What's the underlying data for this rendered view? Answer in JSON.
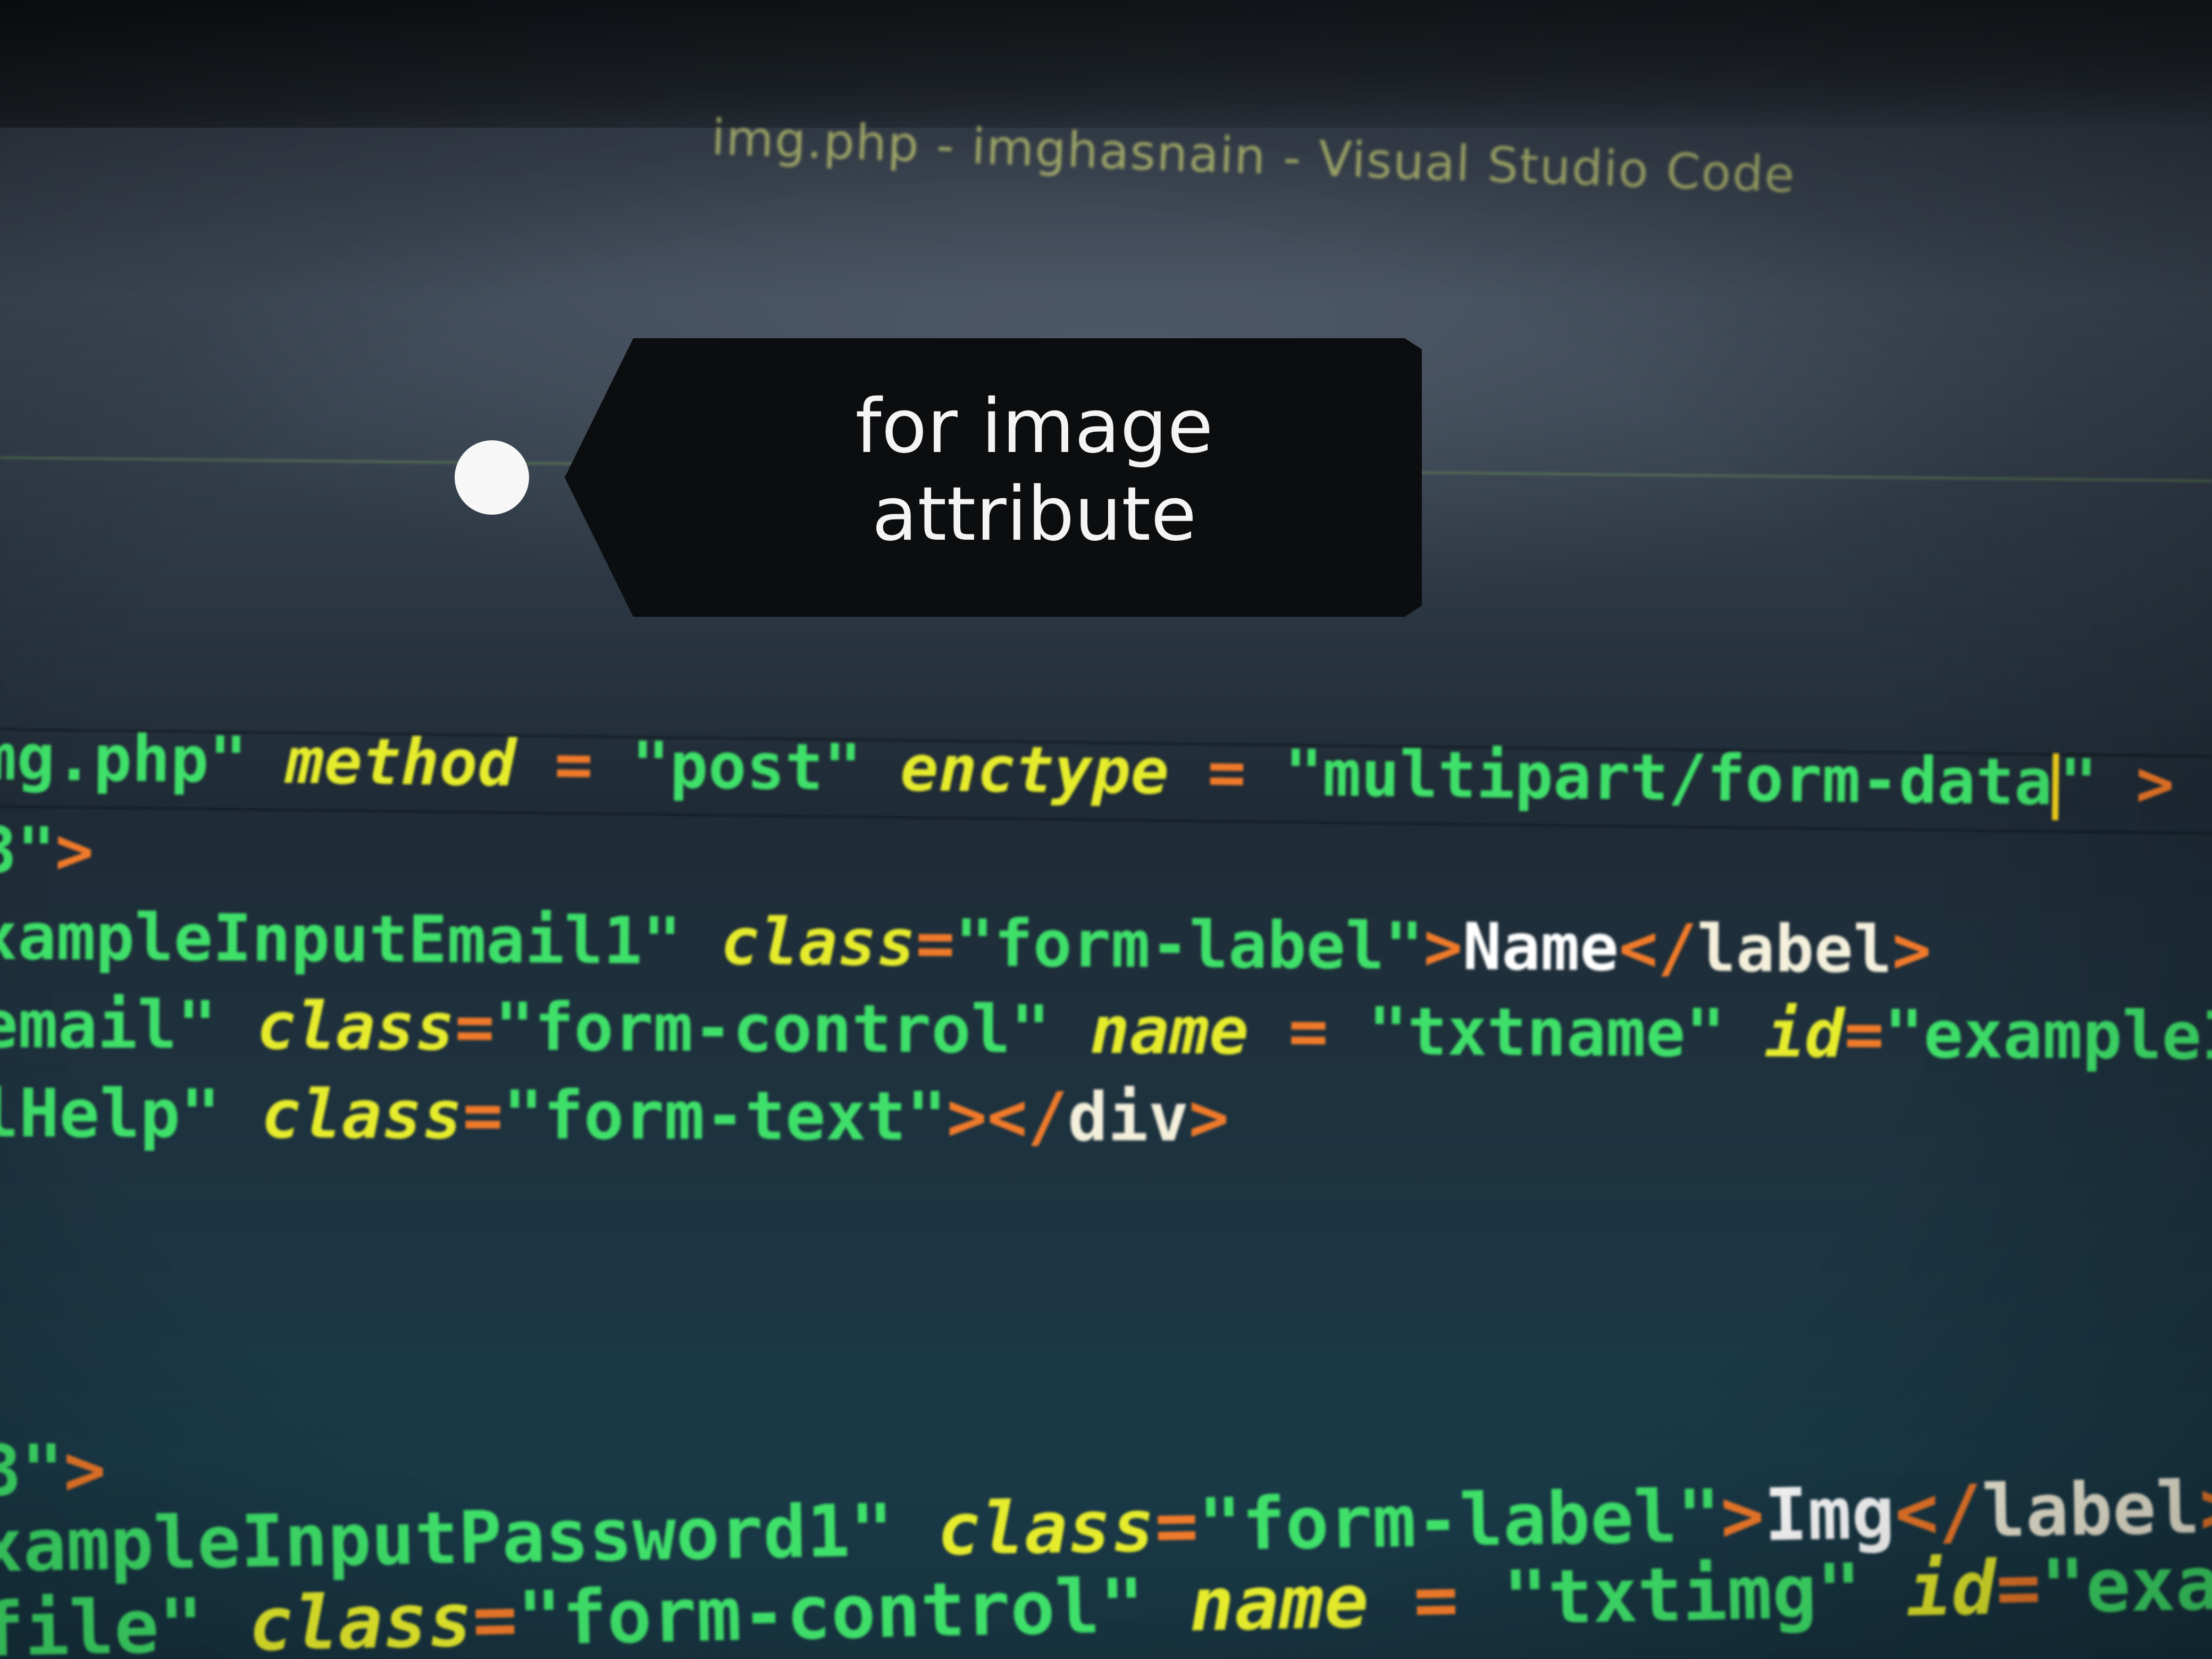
{
  "window": {
    "title": "img.php - imghasnain - Visual Studio Code"
  },
  "callout": {
    "line1": "for image",
    "line2": "attribute"
  },
  "colors": {
    "string": "#3fe06a",
    "attribute": "#e6ec2c",
    "operator": "#f07a2a",
    "tag_text": "#f4f0dc",
    "callout_background": "#0c0d0f",
    "title": "#b5bc70"
  },
  "code_lines": [
    [
      {
        "t": "mg.php\" ",
        "k": "str"
      },
      {
        "t": "method",
        "k": "attr"
      },
      {
        "t": " = ",
        "k": "op"
      },
      {
        "t": "\"post\" ",
        "k": "str"
      },
      {
        "t": "enctype",
        "k": "attr"
      },
      {
        "t": " = ",
        "k": "op"
      },
      {
        "t": "\"multipart/form-data",
        "k": "str"
      },
      {
        "t": "",
        "k": "cursor"
      },
      {
        "t": "\" ",
        "k": "str"
      },
      {
        "t": ">",
        "k": "op"
      }
    ],
    [
      {
        "t": "3\"",
        "k": "str"
      },
      {
        "t": ">",
        "k": "op"
      }
    ],
    [
      {
        "t": "xampleInputEmail1\" ",
        "k": "str"
      },
      {
        "t": "class",
        "k": "attr"
      },
      {
        "t": "=",
        "k": "op"
      },
      {
        "t": "\"form-label\"",
        "k": "str"
      },
      {
        "t": ">",
        "k": "op"
      },
      {
        "t": "Name",
        "k": "white"
      },
      {
        "t": "</",
        "k": "op"
      },
      {
        "t": "label",
        "k": "text"
      },
      {
        "t": ">",
        "k": "op"
      }
    ],
    [
      {
        "t": "email\" ",
        "k": "str"
      },
      {
        "t": "class",
        "k": "attr"
      },
      {
        "t": "=",
        "k": "op"
      },
      {
        "t": "\"form-control\" ",
        "k": "str"
      },
      {
        "t": "name",
        "k": "attr"
      },
      {
        "t": " = ",
        "k": "op"
      },
      {
        "t": "\"txtname\" ",
        "k": "str"
      },
      {
        "t": "id",
        "k": "attr"
      },
      {
        "t": "=",
        "k": "op"
      },
      {
        "t": "\"exampleInputEmail",
        "k": "str"
      }
    ],
    [
      {
        "t": "lHelp\" ",
        "k": "str"
      },
      {
        "t": "class",
        "k": "attr"
      },
      {
        "t": "=",
        "k": "op"
      },
      {
        "t": "\"form-text\"",
        "k": "str"
      },
      {
        "t": "></",
        "k": "op"
      },
      {
        "t": "div",
        "k": "text"
      },
      {
        "t": ">",
        "k": "op"
      }
    ],
    [
      {
        "t": "3\"",
        "k": "str"
      },
      {
        "t": ">",
        "k": "op"
      }
    ],
    [
      {
        "t": "xampleInputPassword1\" ",
        "k": "str"
      },
      {
        "t": "class",
        "k": "attr"
      },
      {
        "t": "=",
        "k": "op"
      },
      {
        "t": "\"form-label\"",
        "k": "str"
      },
      {
        "t": ">",
        "k": "op"
      },
      {
        "t": "Img",
        "k": "white"
      },
      {
        "t": "</",
        "k": "op"
      },
      {
        "t": "label",
        "k": "text"
      },
      {
        "t": ">",
        "k": "op"
      }
    ],
    [
      {
        "t": "file\" ",
        "k": "str"
      },
      {
        "t": "class",
        "k": "attr"
      },
      {
        "t": "=",
        "k": "op"
      },
      {
        "t": "\"form-control\" ",
        "k": "str"
      },
      {
        "t": "name",
        "k": "attr"
      },
      {
        "t": " = ",
        "k": "op"
      },
      {
        "t": "\"txtimg\" ",
        "k": "str"
      },
      {
        "t": "id",
        "k": "attr"
      },
      {
        "t": "=",
        "k": "op"
      },
      {
        "t": "\"exampleInputPasswor",
        "k": "str"
      }
    ]
  ]
}
